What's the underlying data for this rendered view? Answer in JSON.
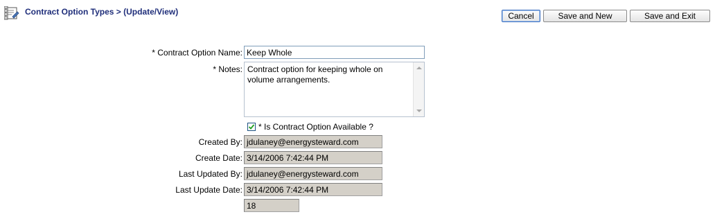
{
  "header": {
    "title": "Contract Option Types > (Update/View)"
  },
  "toolbar": {
    "cancel_label": "Cancel",
    "save_new_label": "Save and New",
    "save_exit_label": "Save and Exit"
  },
  "form": {
    "name_label": "* Contract Option Name:",
    "name_value": "Keep Whole",
    "notes_label": "* Notes:",
    "notes_value": "Contract option for keeping whole on volume arrangements.",
    "available_label": "* Is Contract Option Available ?",
    "available_checked": true,
    "created_by_label": "Created By:",
    "created_by_value": "jdulaney@energysteward.com",
    "create_date_label": "Create Date:",
    "create_date_value": "3/14/2006 7:42:44 PM",
    "last_updated_by_label": "Last Updated By:",
    "last_updated_by_value": "jdulaney@energysteward.com",
    "last_update_date_label": "Last Update Date:",
    "last_update_date_value": "3/14/2006 7:42:44 PM",
    "id_value": "18"
  }
}
